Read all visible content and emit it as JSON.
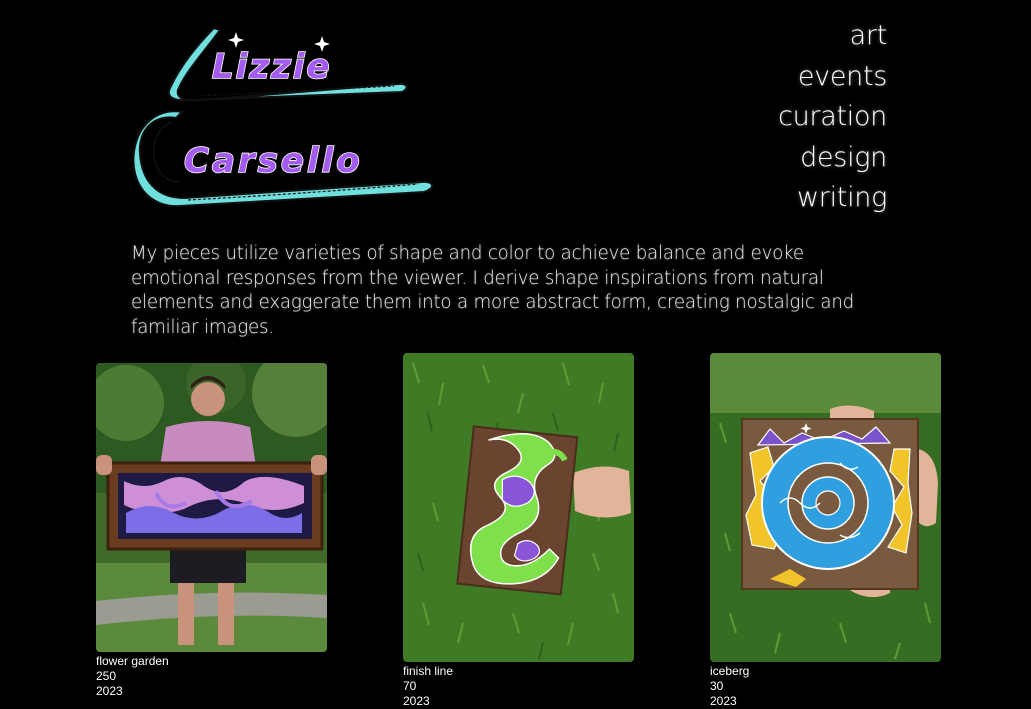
{
  "logo": {
    "line1": "Lizzie",
    "line2": "Carsello",
    "colors": {
      "underline": "#6fe0de",
      "letters": "#a35bf0",
      "outline": "#1a1a1a"
    }
  },
  "nav": {
    "items": [
      {
        "label": "art"
      },
      {
        "label": "events"
      },
      {
        "label": "curation"
      },
      {
        "label": "design"
      },
      {
        "label": "writing"
      }
    ]
  },
  "intro": {
    "text": "My pieces utilize varieties of shape and color to achieve balance and evoke emotional responses from the viewer. I derive shape inspirations from natural elements and exaggerate them into a more abstract form, creating nostalgic and familiar images."
  },
  "artworks": [
    {
      "title": "flower garden",
      "price": "250",
      "year": "2023",
      "colors": [
        "#cf8fd6",
        "#7b6ee6",
        "#6a3f22"
      ]
    },
    {
      "title": "finish line",
      "price": "70",
      "year": "2023",
      "colors": [
        "#7fe04c",
        "#8a55d8",
        "#6b4430"
      ]
    },
    {
      "title": "iceberg",
      "price": "30",
      "year": "2023",
      "colors": [
        "#2f9fe0",
        "#f1c52a",
        "#7a52cc"
      ]
    }
  ]
}
